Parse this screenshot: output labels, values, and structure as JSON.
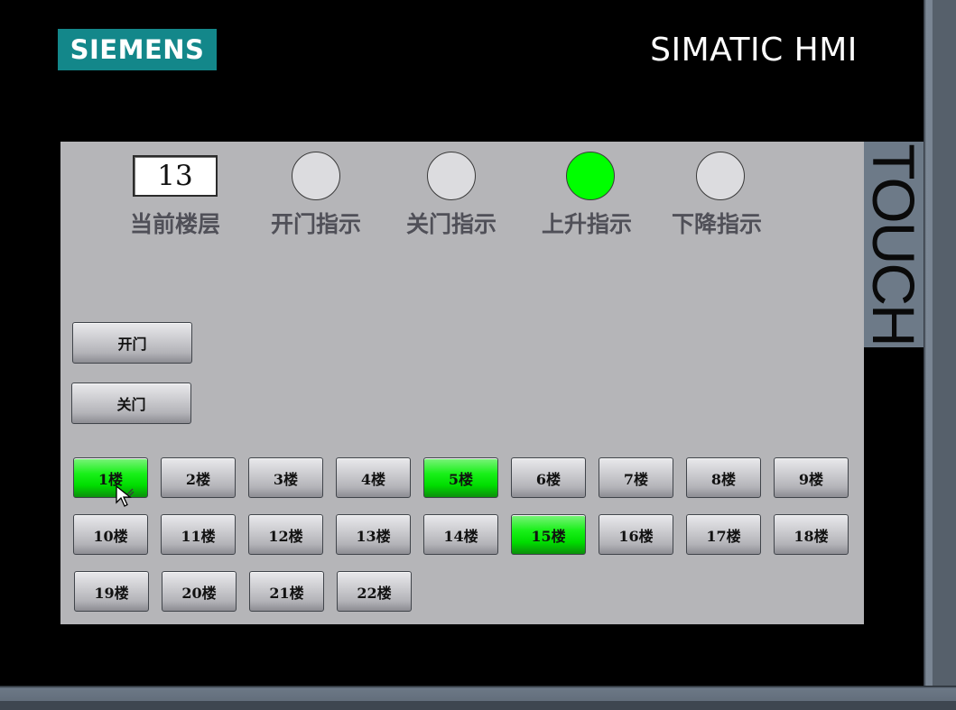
{
  "bezel": {
    "logo": "SIEMENS",
    "brand": "SIMATIC HMI",
    "touch": "TOUCH"
  },
  "status": {
    "current_floor_value": "13",
    "current_floor_label": "当前楼层",
    "indicators": [
      {
        "label": "开门指示",
        "state": "off"
      },
      {
        "label": "关门指示",
        "state": "off"
      },
      {
        "label": "上升指示",
        "state": "on"
      },
      {
        "label": "下降指示",
        "state": "off"
      }
    ]
  },
  "door_buttons": {
    "open": "开门",
    "close": "关门"
  },
  "floor_buttons": [
    {
      "label": "1楼",
      "active": true
    },
    {
      "label": "2楼",
      "active": false
    },
    {
      "label": "3楼",
      "active": false
    },
    {
      "label": "4楼",
      "active": false
    },
    {
      "label": "5楼",
      "active": true
    },
    {
      "label": "6楼",
      "active": false
    },
    {
      "label": "7楼",
      "active": false
    },
    {
      "label": "8楼",
      "active": false
    },
    {
      "label": "9楼",
      "active": false
    },
    {
      "label": "10楼",
      "active": false
    },
    {
      "label": "11楼",
      "active": false
    },
    {
      "label": "12楼",
      "active": false
    },
    {
      "label": "13楼",
      "active": false
    },
    {
      "label": "14楼",
      "active": false
    },
    {
      "label": "15楼",
      "active": true
    },
    {
      "label": "16楼",
      "active": false
    },
    {
      "label": "17楼",
      "active": false
    },
    {
      "label": "18楼",
      "active": false
    },
    {
      "label": "19楼",
      "active": false
    },
    {
      "label": "20楼",
      "active": false
    },
    {
      "label": "21楼",
      "active": false
    },
    {
      "label": "22楼",
      "active": false
    }
  ],
  "colors": {
    "lamp_on": "#00ff00",
    "lamp_off": "#dcdcdf",
    "button_active": "#00dd00",
    "panel_bg": "#b5b5b8",
    "logo_bg": "#13878a"
  },
  "icons": {
    "cursor": "mouse-pointer-icon"
  }
}
